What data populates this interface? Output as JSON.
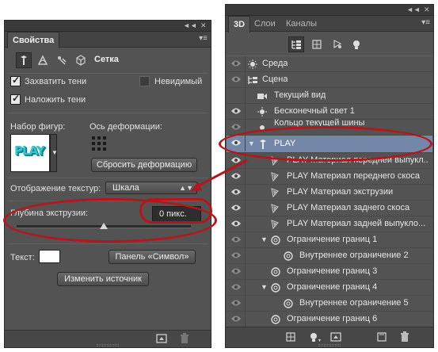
{
  "properties_panel": {
    "collapse_label": "◄◄",
    "close_label": "✕",
    "tab": "Свойства",
    "menu_icon": "panel-menu-icon",
    "header_title": "Сетка",
    "capture_shadows": "Захватить тени",
    "invisible": "Невидимый",
    "cast_shadows": "Наложить тени",
    "shape_preset_label": "Набор фигур:",
    "preset_text": "PLAY",
    "deform_axis_label": "Ось деформации:",
    "reset_deformation": "Сбросить деформацию",
    "texture_mapping_label": "Отображение текстур:",
    "texture_mapping_value": "Шкала",
    "extrusion_depth_label": "Глубина экструзии:",
    "extrusion_depth_value": "0 пикс.",
    "extrusion_slider_level": 0.5,
    "text_label": "Текст:",
    "character_panel": "Панель «Символ»",
    "edit_source": "Изменить источник"
  },
  "layers_panel": {
    "collapse_label": "◄◄",
    "close_label": "✕",
    "tabs": [
      "3D",
      "Слои",
      "Каналы"
    ],
    "active_tab": "3D",
    "rows": [
      {
        "label": "Среда",
        "icon": "environment-icon"
      },
      {
        "label": "Сцена",
        "icon": "scene-icon"
      },
      {
        "label": "Текущий вид",
        "icon": "camera-icon"
      },
      {
        "label": "Бесконечный свет 1",
        "icon": "light-icon"
      },
      {
        "label": "Кольцо текущей шины",
        "icon": "light-icon"
      },
      {
        "label": "PLAY",
        "icon": "mesh-icon"
      },
      {
        "label": "PLAY Материал передней выпукл...",
        "icon": "material-icon"
      },
      {
        "label": "PLAY Материал переднего скоса",
        "icon": "material-icon"
      },
      {
        "label": "PLAY Материал экструзии",
        "icon": "material-icon"
      },
      {
        "label": "PLAY Материал заднего скоса",
        "icon": "material-icon"
      },
      {
        "label": "PLAY Материал задней выпукло...",
        "icon": "material-icon"
      },
      {
        "label": "Ограничение границ 1",
        "icon": "constraint-icon"
      },
      {
        "label": "Внутреннее ограничение 2",
        "icon": "constraint-icon"
      },
      {
        "label": "Ограничение границ 3",
        "icon": "constraint-icon"
      },
      {
        "label": "Ограничение границ 4",
        "icon": "constraint-icon"
      },
      {
        "label": "Внутреннее ограничение 5",
        "icon": "constraint-icon"
      },
      {
        "label": "Ограничение границ 6",
        "icon": "constraint-icon"
      }
    ]
  },
  "colors": {
    "highlight": "#b5161b",
    "selection": "#7587a8",
    "panel_bg": "#535353",
    "preset_letters": "#35c4d4"
  }
}
